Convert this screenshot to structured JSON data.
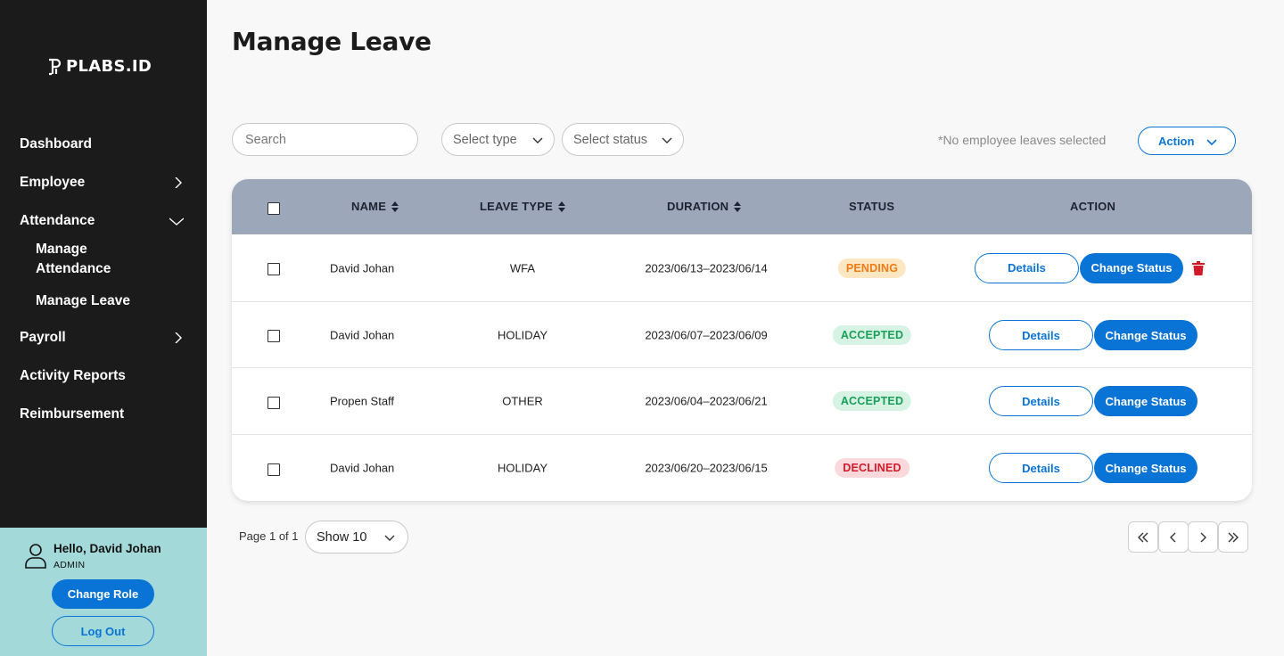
{
  "brand": {
    "name": "PLABS.ID"
  },
  "sidebar": {
    "items": [
      {
        "label": "Dashboard"
      },
      {
        "label": "Employee"
      },
      {
        "label": "Attendance"
      },
      {
        "label": "Payroll"
      },
      {
        "label": "Activity Reports"
      },
      {
        "label": "Reimbursement"
      }
    ],
    "attendance_sub": [
      {
        "label": "Manage Attendance"
      },
      {
        "label": "Manage Leave"
      }
    ]
  },
  "user": {
    "greeting": "Hello, David Johan",
    "role": "ADMIN",
    "change_role_label": "Change Role",
    "logout_label": "Log Out"
  },
  "page": {
    "title": "Manage Leave"
  },
  "filters": {
    "search_placeholder": "Search",
    "type_placeholder": "Select type",
    "status_placeholder": "Select status",
    "no_selection_text": "*No employee leaves selected",
    "action_label": "Action"
  },
  "table": {
    "headers": {
      "name": "NAME",
      "leave_type": "LEAVE TYPE",
      "duration": "DURATION",
      "status": "STATUS",
      "action": "ACTION"
    },
    "rows": [
      {
        "name": "David Johan",
        "leave_type": "WFA",
        "duration": "2023/06/13–2023/06/14",
        "status": "PENDING"
      },
      {
        "name": "David Johan",
        "leave_type": "HOLIDAY",
        "duration": "2023/06/07–2023/06/09",
        "status": "ACCEPTED"
      },
      {
        "name": "Propen Staff",
        "leave_type": "OTHER",
        "duration": "2023/06/04–2023/06/21",
        "status": "ACCEPTED"
      },
      {
        "name": "David Johan",
        "leave_type": "HOLIDAY",
        "duration": "2023/06/20–2023/06/15",
        "status": "DECLINED"
      }
    ],
    "details_label": "Details",
    "change_status_label": "Change Status"
  },
  "pagination": {
    "page_info": "Page 1 of 1",
    "show_label": "Show 10"
  },
  "colors": {
    "sidebar_bg": "#1b1b1b",
    "accent": "#0a74d6",
    "user_box_bg": "#a3d9d9",
    "table_header_bg": "#9ca7b9",
    "pending": "#f07a14",
    "accepted": "#1aa05a",
    "declined": "#d11a2a",
    "delete_icon": "#d11a2a"
  }
}
